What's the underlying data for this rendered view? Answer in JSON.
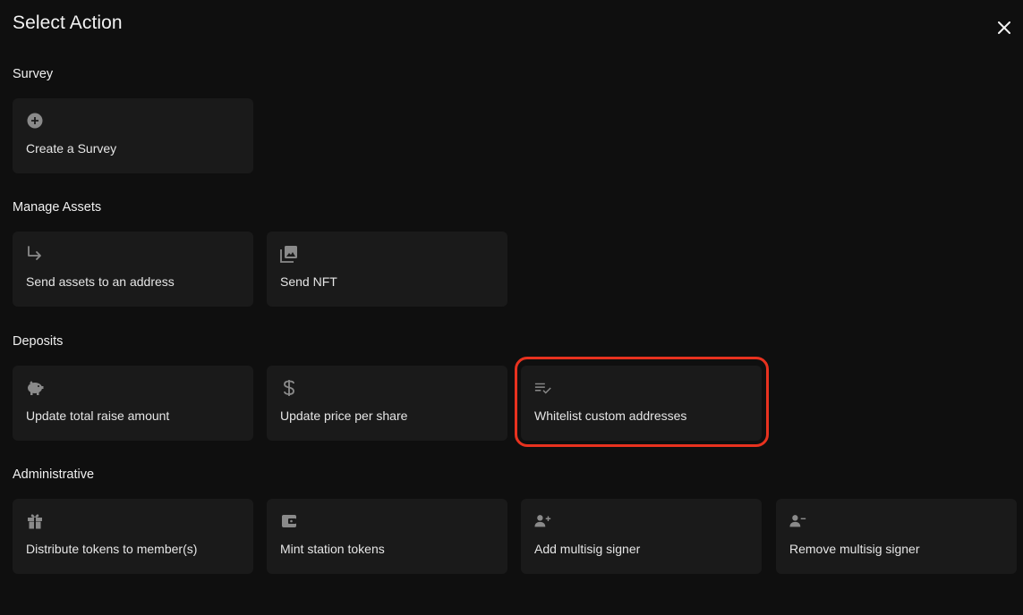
{
  "modal": {
    "title": "Select Action",
    "close_icon": "close-icon"
  },
  "sections": {
    "survey": {
      "title": "Survey",
      "items": [
        {
          "label": "Create a Survey",
          "icon": "add-circle-icon"
        }
      ]
    },
    "manage_assets": {
      "title": "Manage Assets",
      "items": [
        {
          "label": "Send assets to an address",
          "icon": "forward-arrow-icon"
        },
        {
          "label": "Send NFT",
          "icon": "image-collection-icon"
        }
      ]
    },
    "deposits": {
      "title": "Deposits",
      "items": [
        {
          "label": "Update total raise amount",
          "icon": "piggy-bank-icon"
        },
        {
          "label": "Update price per share",
          "icon": "dollar-icon"
        },
        {
          "label": "Whitelist custom addresses",
          "icon": "checklist-icon"
        }
      ]
    },
    "administrative": {
      "title": "Administrative",
      "items": [
        {
          "label": "Distribute tokens to member(s)",
          "icon": "gift-icon"
        },
        {
          "label": "Mint station tokens",
          "icon": "wallet-icon"
        },
        {
          "label": "Add multisig signer",
          "icon": "person-add-icon"
        },
        {
          "label": "Remove multisig signer",
          "icon": "person-remove-icon"
        }
      ]
    }
  },
  "colors": {
    "background": "#0f0f0f",
    "card": "#1a1a1a",
    "icon": "#8a8a8a",
    "highlight": "#e8321f"
  }
}
